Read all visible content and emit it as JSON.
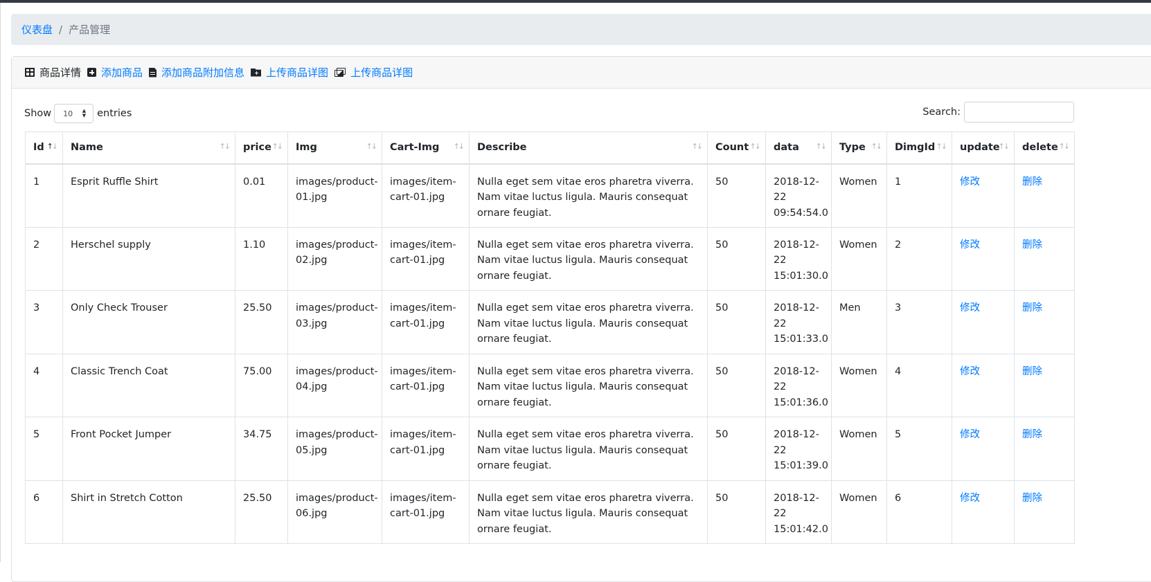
{
  "breadcrumb": {
    "home": "仪表盘",
    "separator": "/",
    "current": "产品管理"
  },
  "card_header": {
    "title": "商品详情",
    "links": [
      "添加商品",
      "添加商品附加信息",
      "上传商品详图",
      "上传商品详图"
    ],
    "icons": [
      "table-icon",
      "plus-square-icon",
      "file-icon",
      "folder-plus-icon",
      "images-icon"
    ]
  },
  "controls": {
    "show_label": "Show",
    "page_size": "10",
    "entries_label": "entries",
    "search_label": "Search:",
    "search_value": ""
  },
  "table": {
    "columns": [
      "Id",
      "Name",
      "price",
      "Img",
      "Cart-Img",
      "Describe",
      "Count",
      "data",
      "Type",
      "DimgId",
      "update",
      "delete"
    ],
    "sorted_column": "Id",
    "sort_direction": "ascending",
    "rows": [
      [
        "1",
        "Esprit Ruffle Shirt",
        "0.01",
        "images/product-01.jpg",
        "images/item-cart-01.jpg",
        "Nulla eget sem vitae eros pharetra viverra. Nam vitae luctus ligula. Mauris consequat ornare feugiat.",
        "50",
        "2018-12-22 09:54:54.0",
        "Women",
        "1",
        "修改",
        "删除"
      ],
      [
        "2",
        "Herschel supply",
        "1.10",
        "images/product-02.jpg",
        "images/item-cart-01.jpg",
        "Nulla eget sem vitae eros pharetra viverra. Nam vitae luctus ligula. Mauris consequat ornare feugiat.",
        "50",
        "2018-12-22 15:01:30.0",
        "Women",
        "2",
        "修改",
        "删除"
      ],
      [
        "3",
        "Only Check Trouser",
        "25.50",
        "images/product-03.jpg",
        "images/item-cart-01.jpg",
        "Nulla eget sem vitae eros pharetra viverra. Nam vitae luctus ligula. Mauris consequat ornare feugiat.",
        "50",
        "2018-12-22 15:01:33.0",
        "Men",
        "3",
        "修改",
        "删除"
      ],
      [
        "4",
        "Classic Trench Coat",
        "75.00",
        "images/product-04.jpg",
        "images/item-cart-01.jpg",
        "Nulla eget sem vitae eros pharetra viverra. Nam vitae luctus ligula. Mauris consequat ornare feugiat.",
        "50",
        "2018-12-22 15:01:36.0",
        "Women",
        "4",
        "修改",
        "删除"
      ],
      [
        "5",
        "Front Pocket Jumper",
        "34.75",
        "images/product-05.jpg",
        "images/item-cart-01.jpg",
        "Nulla eget sem vitae eros pharetra viverra. Nam vitae luctus ligula. Mauris consequat ornare feugiat.",
        "50",
        "2018-12-22 15:01:39.0",
        "Women",
        "5",
        "修改",
        "删除"
      ],
      [
        "6",
        "Shirt in Stretch Cotton",
        "25.50",
        "images/product-06.jpg",
        "images/item-cart-01.jpg",
        "Nulla eget sem vitae eros pharetra viverra. Nam vitae luctus ligula. Mauris consequat ornare feugiat.",
        "50",
        "2018-12-22 15:01:42.0",
        "Women",
        "6",
        "修改",
        "删除"
      ]
    ]
  },
  "colors": {
    "link": "#007bff",
    "breadcrumb_bg": "#e9ecef",
    "header_bg": "#f7f7f7",
    "topbar": "#343a40"
  }
}
